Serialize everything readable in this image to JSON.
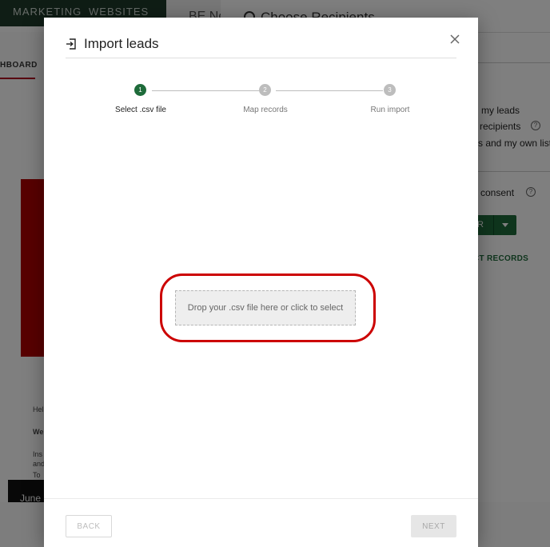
{
  "background": {
    "nav": {
      "marketing": "MARKETING",
      "websites": "WEBSITES"
    },
    "doc_title": "BE No",
    "panel_title": "Choose Recipients",
    "dashboard_tab": "HBOARD",
    "left_snippets": [
      "Hel",
      "We",
      "Ins",
      "and",
      "To"
    ],
    "black_box_text": "June",
    "right_panel": {
      "option_1": "my leads",
      "option_2": "recipients",
      "option_3": "s and my own list",
      "consent": "g consent",
      "split_button_label": "R",
      "select_records": "CT RECORDS"
    }
  },
  "modal": {
    "title": "Import leads",
    "steps": [
      {
        "number": "1",
        "label": "Select .csv file",
        "active": true
      },
      {
        "number": "2",
        "label": "Map records",
        "active": false
      },
      {
        "number": "3",
        "label": "Run import",
        "active": false
      }
    ],
    "dropzone_text": "Drop your .csv file here or click to select",
    "footer": {
      "back_label": "BACK",
      "next_label": "NEXT"
    }
  },
  "colors": {
    "accent_green": "#1e6b3a",
    "highlight_red": "#cc0000",
    "overlay": "rgba(0,0,0,0.5)"
  }
}
